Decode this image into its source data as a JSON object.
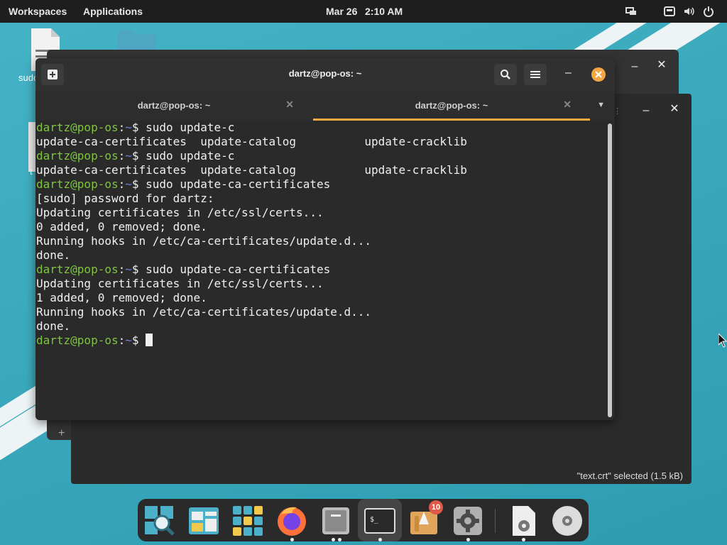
{
  "topbar": {
    "workspaces": "Workspaces",
    "applications": "Applications",
    "date": "Mar 26",
    "time": "2:10 AM"
  },
  "desktop": {
    "icon1_label": "sudo",
    "icon2_label": "t"
  },
  "back_window": {
    "status": "\"text.crt\" selected  (1.5 kB)"
  },
  "terminal": {
    "title": "dartz@pop-os: ~",
    "tabs": [
      {
        "label": "dartz@pop-os: ~"
      },
      {
        "label": "dartz@pop-os: ~"
      }
    ],
    "lines": [
      {
        "user": "dartz@pop-os",
        "path": "~",
        "cmd": " sudo update-c"
      },
      {
        "text": "update-ca-certificates  update-catalog          update-cracklib"
      },
      {
        "user": "dartz@pop-os",
        "path": "~",
        "cmd": " sudo update-c"
      },
      {
        "text": "update-ca-certificates  update-catalog          update-cracklib"
      },
      {
        "user": "dartz@pop-os",
        "path": "~",
        "cmd": " sudo update-ca-certificates"
      },
      {
        "text": "[sudo] password for dartz:"
      },
      {
        "text": "Updating certificates in /etc/ssl/certs..."
      },
      {
        "text": "0 added, 0 removed; done."
      },
      {
        "text": "Running hooks in /etc/ca-certificates/update.d..."
      },
      {
        "text": "done."
      },
      {
        "user": "dartz@pop-os",
        "path": "~",
        "cmd": " sudo update-ca-certificates"
      },
      {
        "text": "Updating certificates in /etc/ssl/certs..."
      },
      {
        "text": "1 added, 0 removed; done."
      },
      {
        "text": "Running hooks in /etc/ca-certificates/update.d..."
      },
      {
        "text": "done."
      },
      {
        "user": "dartz@pop-os",
        "path": "~",
        "cmd": " ",
        "cursor": true
      }
    ]
  },
  "dock": {
    "badge": "10",
    "terminal_glyph": "$_",
    "items": [
      "search-app",
      "files-app",
      "app-grid",
      "firefox",
      "file-manager",
      "terminal",
      "pop-shop",
      "settings",
      "document-settings",
      "disc"
    ]
  },
  "colors": {
    "prompt_user": "#7fc43e",
    "prompt_path": "#6b7ee0",
    "accent": "#f5a742",
    "close": "#f5a742"
  }
}
